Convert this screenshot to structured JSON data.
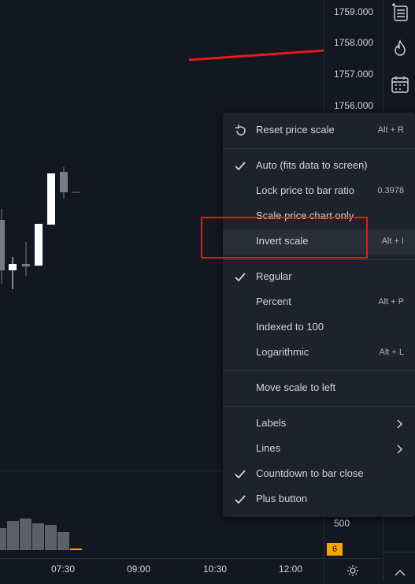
{
  "price_scale": {
    "labels": [
      "1759.000",
      "1758.000",
      "1757.000",
      "1756.000"
    ],
    "volume_label": "500",
    "countdown_value": "6"
  },
  "time_axis": {
    "labels": [
      "07:30",
      "09:00",
      "10:30",
      "12:00"
    ]
  },
  "context_menu": {
    "reset": {
      "label": "Reset price scale",
      "shortcut": "Alt + R",
      "icon": "reset-icon"
    },
    "auto": {
      "label": "Auto (fits data to screen)",
      "checked": true
    },
    "lock": {
      "label": "Lock price to bar ratio",
      "value": "0.3978"
    },
    "scale_only": {
      "label": "Scale price chart only"
    },
    "invert": {
      "label": "Invert scale",
      "shortcut": "Alt + I"
    },
    "regular": {
      "label": "Regular",
      "checked": true
    },
    "percent": {
      "label": "Percent",
      "shortcut": "Alt + P"
    },
    "indexed": {
      "label": "Indexed to 100"
    },
    "log": {
      "label": "Logarithmic",
      "shortcut": "Alt + L"
    },
    "move_left": {
      "label": "Move scale to left"
    },
    "labels": {
      "label": "Labels",
      "submenu": true
    },
    "lines": {
      "label": "Lines",
      "submenu": true
    },
    "countdown": {
      "label": "Countdown to bar close",
      "checked": true
    },
    "plus": {
      "label": "Plus button",
      "checked": true
    }
  },
  "toolbar_icons": [
    "watchlist-icon",
    "hotlist-icon",
    "calendar-icon",
    "chat-icon"
  ],
  "colors": {
    "background": "#131722",
    "menu_bg": "#1e222d",
    "text": "#d1d4dc",
    "annotation_red": "#e31b1b",
    "countdown_badge": "#f7a600",
    "candle_up": "#ffffff",
    "candle_down": "#787b86"
  }
}
